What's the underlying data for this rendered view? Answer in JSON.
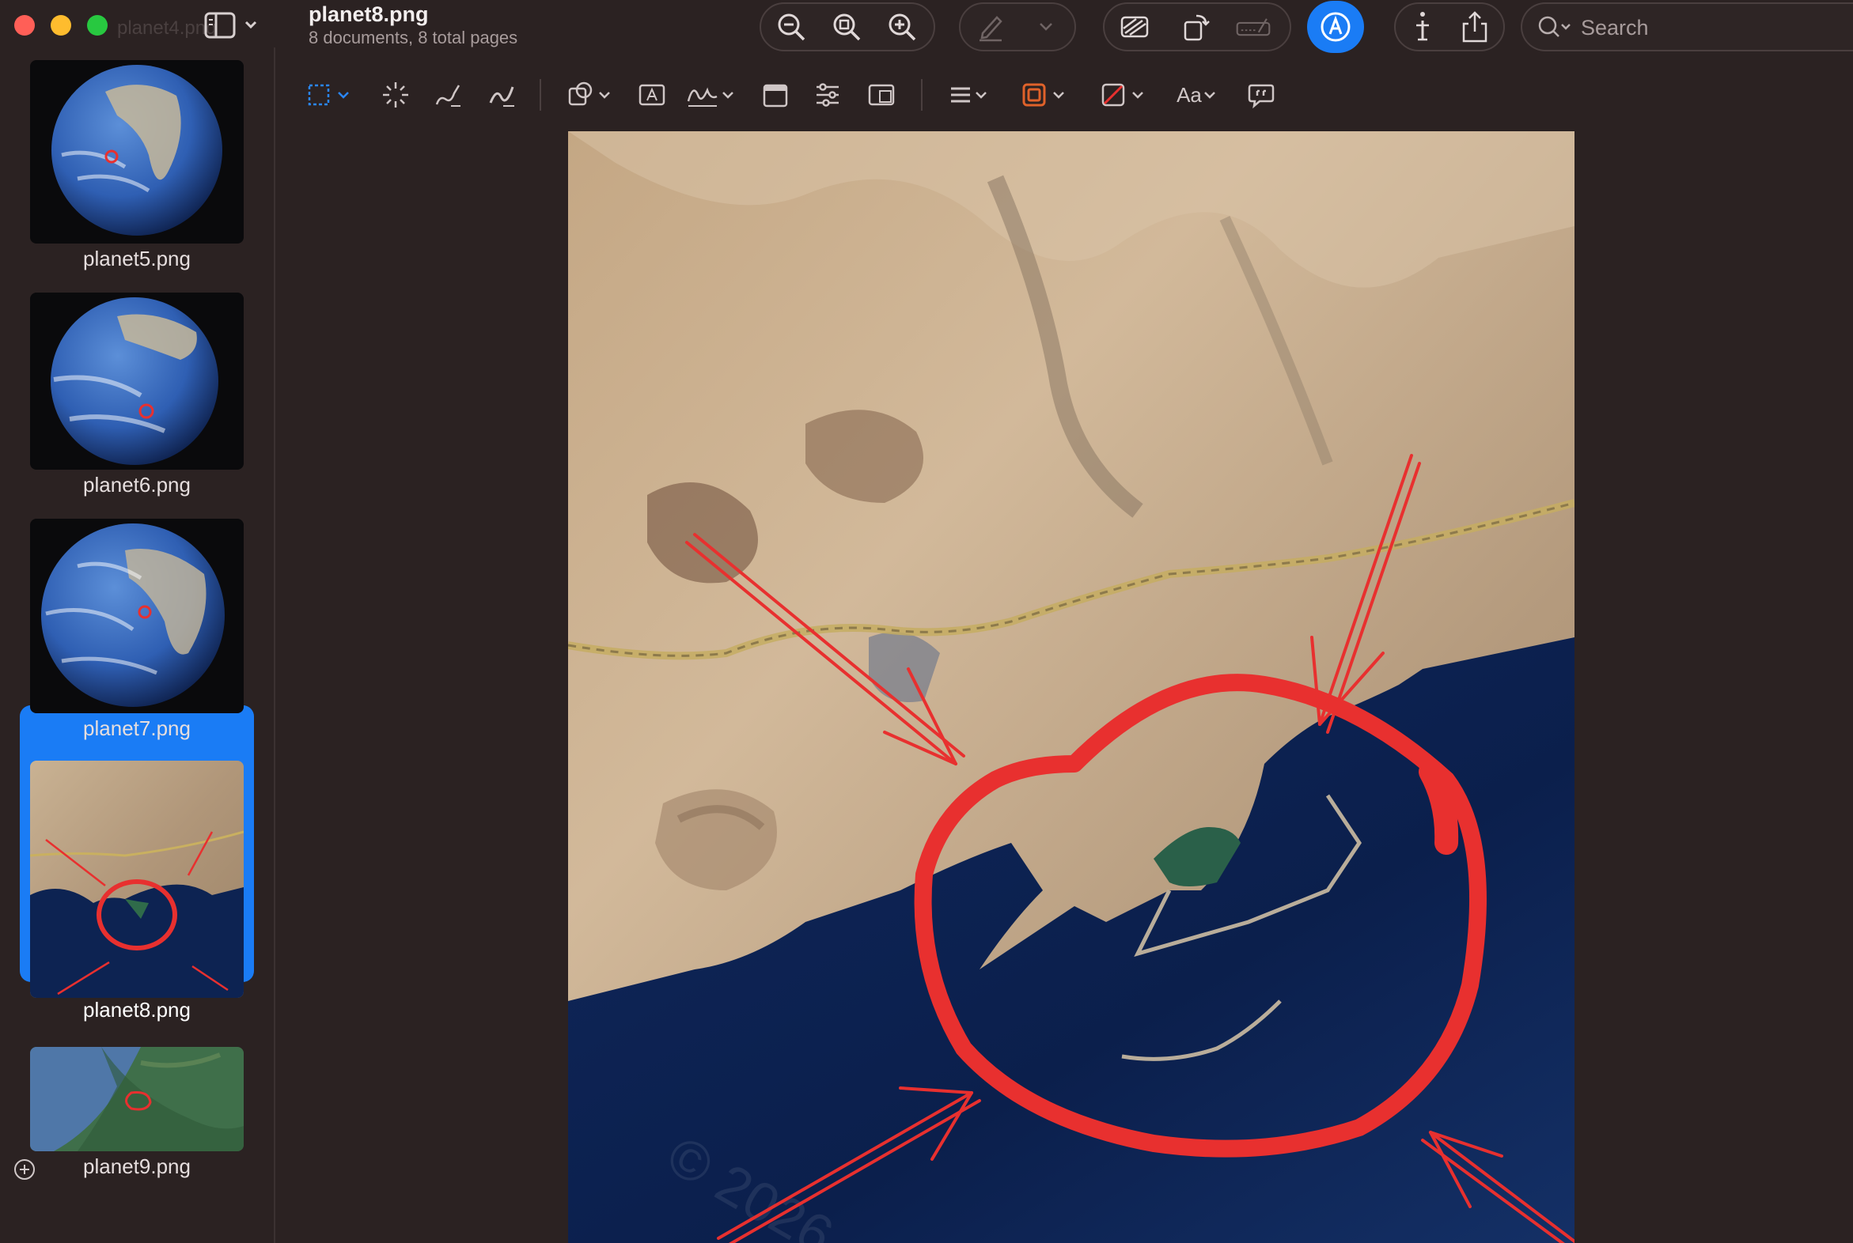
{
  "window": {
    "ghost_filename": "planet4.png",
    "title": "planet8.png",
    "subtitle": "8 documents, 8 total pages"
  },
  "toolbar": {
    "search_placeholder": "Search",
    "buttons": [
      "zoom-out-icon",
      "zoom-fit-icon",
      "zoom-in-icon",
      "highlight-pen-icon",
      "chevron-down-icon",
      "redact-icon",
      "rotate-icon",
      "signature-bar-icon",
      "markup-icon",
      "info-icon",
      "share-icon",
      "search-icon"
    ]
  },
  "markup_toolbar": {
    "text_style_label": "Aa",
    "border_color": "#e0622a",
    "accent": "#1a7cf5"
  },
  "sidebar": {
    "thumbnails": [
      {
        "label": "planet5.png",
        "kind": "globe"
      },
      {
        "label": "planet6.png",
        "kind": "globe"
      },
      {
        "label": "planet7.png",
        "kind": "globe"
      },
      {
        "label": "planet8.png",
        "kind": "satellite-coast",
        "selected": true
      },
      {
        "label": "planet9.png",
        "kind": "satellite-green"
      }
    ]
  },
  "canvas": {
    "annotation_color": "#e8302f",
    "watermark": "© 2026"
  }
}
